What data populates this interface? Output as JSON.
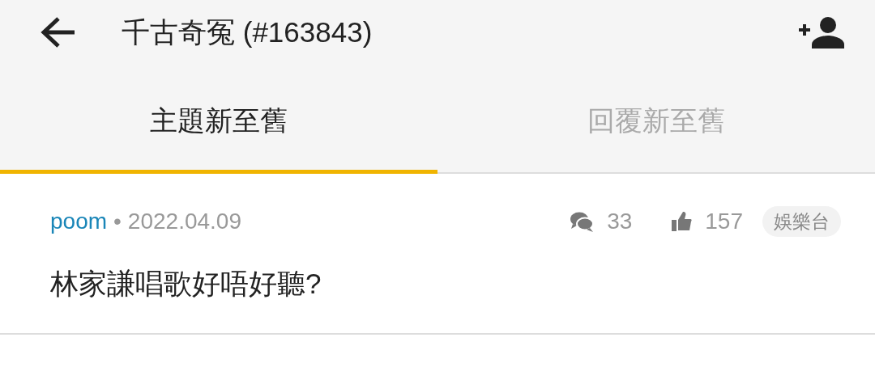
{
  "app_bar": {
    "title": "千古奇冤 (#163843)"
  },
  "tabs": [
    {
      "label": "主題新至舊",
      "selected": true
    },
    {
      "label": "回覆新至舊",
      "selected": false
    }
  ],
  "posts": [
    {
      "author": "poom",
      "separator": "•",
      "date": "2022.04.09",
      "replies": "33",
      "likes": "157",
      "category": "娛樂台",
      "title": "林家謙唱歌好唔好聽?"
    }
  ]
}
